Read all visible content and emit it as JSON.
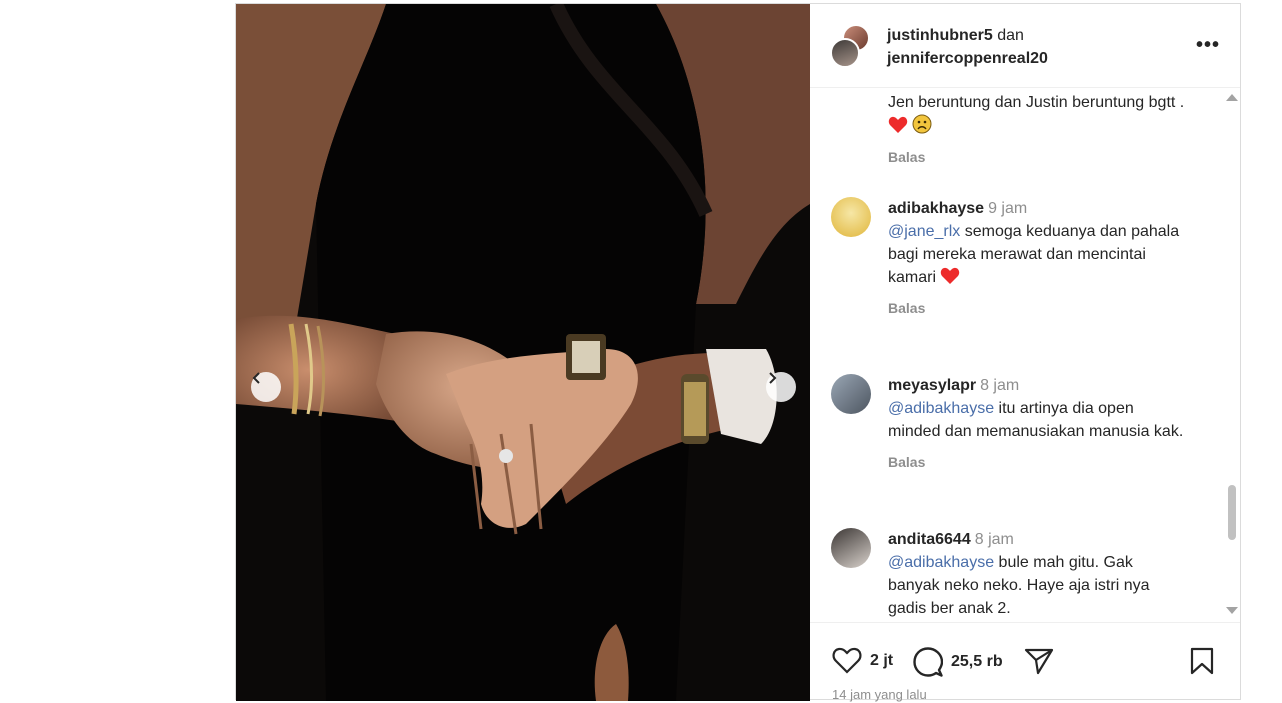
{
  "header": {
    "user1": "justinhubner5",
    "connector": "dan",
    "user2": "jennifercoppenreal20",
    "more": "•••"
  },
  "comments": [
    {
      "text": "Jen beruntung dan Justin beruntung bgtt .",
      "emoji": [
        "red-heart",
        "worried-face"
      ],
      "reply": "Balas"
    },
    {
      "user": "adibakhayse",
      "time": "9 jam",
      "mention": "@jane_rlx",
      "text": "semoga keduanya dan pahala bagi mereka merawat dan mencintai kamari",
      "emoji": [
        "red-heart"
      ],
      "reply": "Balas"
    },
    {
      "user": "meyasylapr",
      "time": "8 jam",
      "mention": "@adibakhayse",
      "text": "itu artinya dia open minded dan memanusiakan manusia kak.",
      "reply": "Balas"
    },
    {
      "user": "andita6644",
      "time": "8 jam",
      "mention": "@adibakhayse",
      "text": "bule mah gitu. Gak banyak neko neko. Haye aja istri nya gadis ber anak 2."
    }
  ],
  "actions": {
    "likes": "2 jt",
    "comments": "25,5 rb"
  },
  "timestamp": "14 jam yang lalu",
  "colors": {
    "heart": "#ed2b2b",
    "mention": "#4a6ea9",
    "muted": "#8e8e8e"
  }
}
